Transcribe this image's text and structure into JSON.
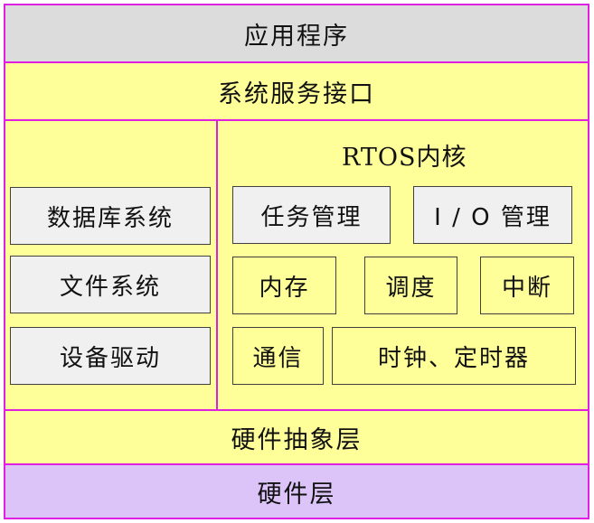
{
  "colors": {
    "border_accent": "#e020e0",
    "application_bg": "#dcdcdc",
    "yellow_bg": "#ffff99",
    "gray_box_bg": "#f0f0f0",
    "hardware_bg": "#dcc4f8"
  },
  "layers": {
    "application": "应用程序",
    "system_service_interface": "系统服务接口",
    "hardware_abstraction": "硬件抽象层",
    "hardware": "硬件层"
  },
  "left_panel": {
    "items": [
      "数据库系统",
      "文件系统",
      "设备驱动"
    ]
  },
  "rtos_kernel": {
    "title": "RTOS内核",
    "task_management": "任务管理",
    "io_management": "I / O 管理",
    "memory": "内存",
    "scheduling": "调度",
    "interrupt": "中断",
    "communication": "通信",
    "clock_timer": "时钟、定时器"
  }
}
